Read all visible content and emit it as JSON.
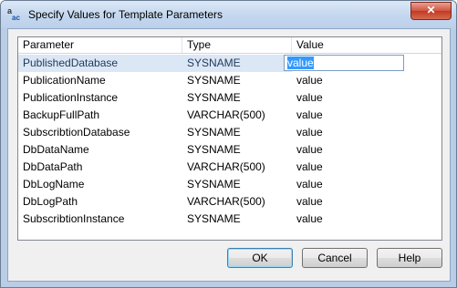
{
  "window": {
    "title": "Specify Values for Template Parameters",
    "close_label": "✕"
  },
  "grid": {
    "columns": [
      "Parameter",
      "Type",
      "Value"
    ],
    "rows": [
      {
        "parameter": "PublishedDatabase",
        "type": "SYSNAME",
        "value": "value"
      },
      {
        "parameter": "PublicationName",
        "type": "SYSNAME",
        "value": "value"
      },
      {
        "parameter": "PublicationInstance",
        "type": "SYSNAME",
        "value": "value"
      },
      {
        "parameter": "BackupFullPath",
        "type": "VARCHAR(500)",
        "value": "value"
      },
      {
        "parameter": "SubscribtionDatabase",
        "type": "SYSNAME",
        "value": "value"
      },
      {
        "parameter": "DbDataName",
        "type": "SYSNAME",
        "value": "value"
      },
      {
        "parameter": "DbDataPath",
        "type": "VARCHAR(500)",
        "value": "value"
      },
      {
        "parameter": "DbLogName",
        "type": "SYSNAME",
        "value": "value"
      },
      {
        "parameter": "DbLogPath",
        "type": "VARCHAR(500)",
        "value": "value"
      },
      {
        "parameter": "SubscribtionInstance",
        "type": "SYSNAME",
        "value": "value"
      }
    ]
  },
  "buttons": {
    "ok": "OK",
    "cancel": "Cancel",
    "help": "Help"
  },
  "icons": {
    "app": "template-parameters-icon",
    "close": "close-icon"
  }
}
